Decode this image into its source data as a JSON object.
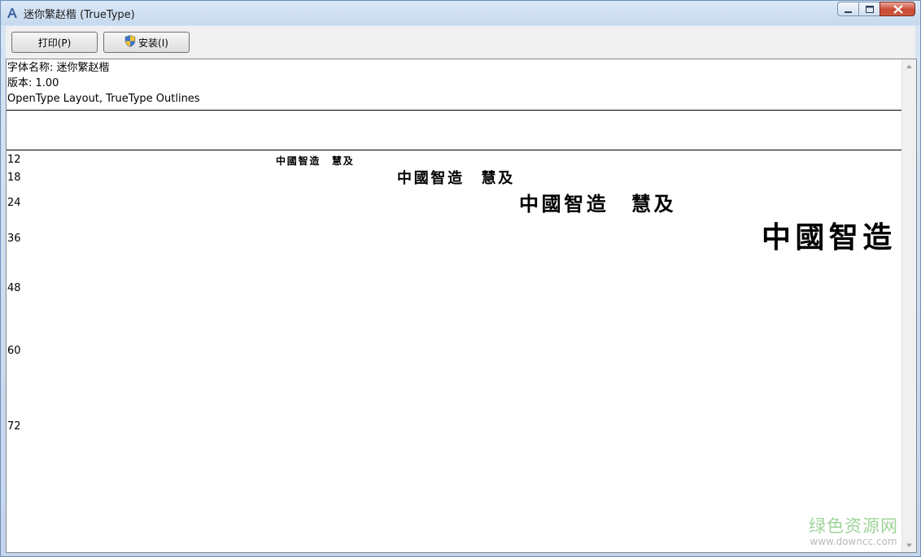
{
  "window": {
    "title": "迷你繁赵楷 (TrueType)",
    "icon": "font-icon"
  },
  "toolbar": {
    "print_label": "打印(P)",
    "install_label": "安装(I)",
    "install_icon": "uac-shield-icon"
  },
  "info": {
    "font_name": "字体名称: 迷你繁赵楷",
    "version": "版本: 1.00",
    "outline": "OpenType Layout, TrueType Outlines"
  },
  "samples": {
    "sizes": [
      {
        "label": "12",
        "text": "中國智造　慧及"
      },
      {
        "label": "18",
        "text": "中國智造　慧及"
      },
      {
        "label": "24",
        "text": "中國智造　慧及"
      },
      {
        "label": "36",
        "text": "中國智造"
      },
      {
        "label": "48",
        "text": ""
      },
      {
        "label": "60",
        "text": ""
      },
      {
        "label": "72",
        "text": ""
      }
    ]
  },
  "watermark": {
    "cn": "绿色资源网",
    "en": "www.downcc.com"
  },
  "colors": {
    "title_bg": "#c7d9ee",
    "close_btn": "#c94a33",
    "watermark_green": "#9fd39a"
  }
}
